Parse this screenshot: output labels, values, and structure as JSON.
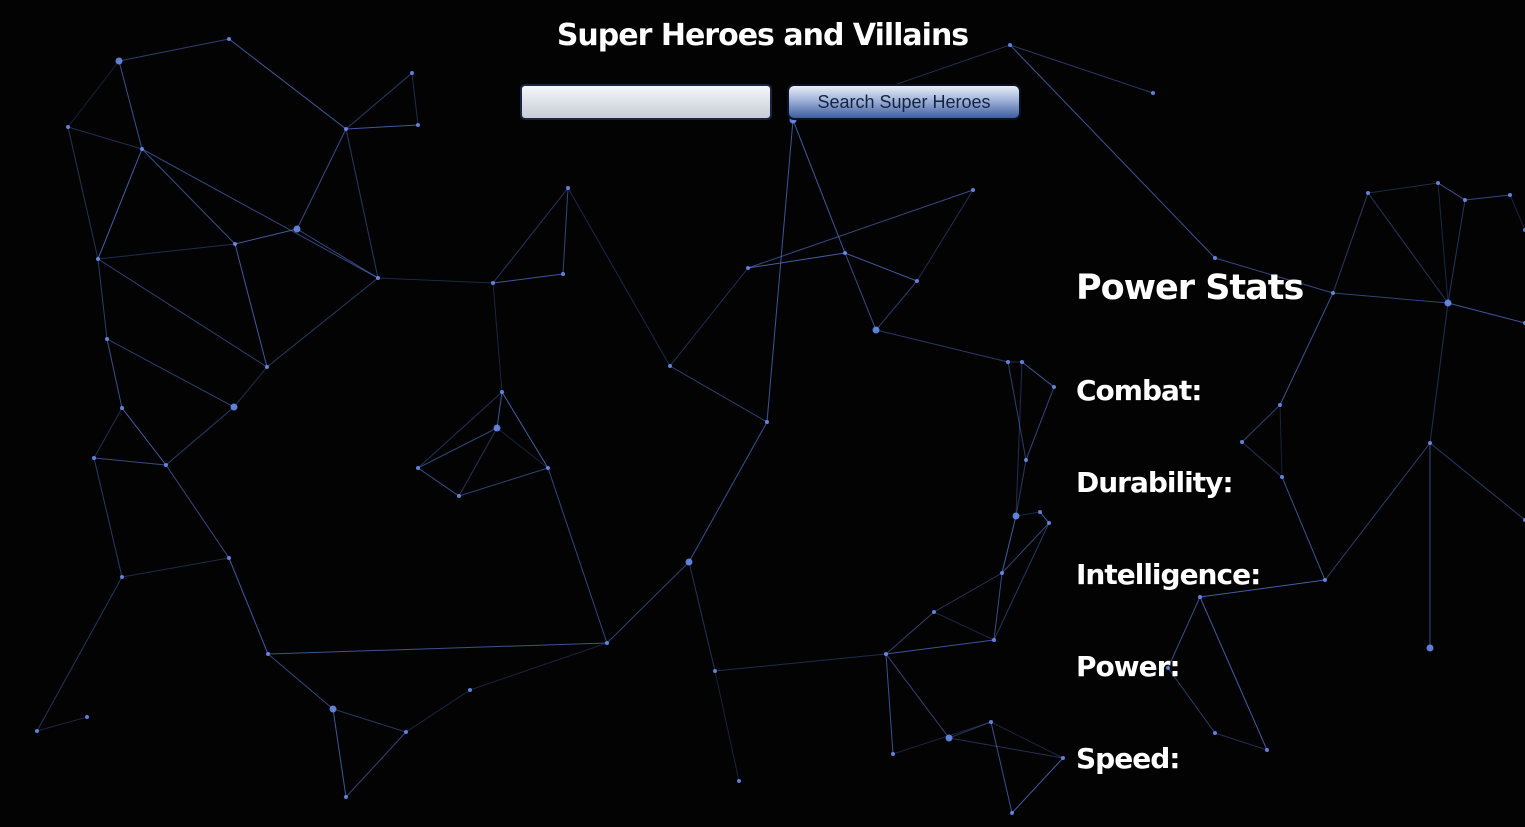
{
  "header": {
    "title": "Super Heroes and Villains"
  },
  "search": {
    "value": "",
    "placeholder": "",
    "button_label": "Search Super Heroes"
  },
  "power_stats": {
    "heading": "Power Stats",
    "items": [
      {
        "label": "Combat:",
        "value": ""
      },
      {
        "label": "Durability:",
        "value": ""
      },
      {
        "label": "Intelligence:",
        "value": ""
      },
      {
        "label": "Power:",
        "value": ""
      },
      {
        "label": "Speed:",
        "value": ""
      }
    ]
  },
  "colors": {
    "background": "#030303",
    "network_line": "#5b7fe0",
    "network_node": "#6f93f5",
    "text": "#ffffff"
  }
}
